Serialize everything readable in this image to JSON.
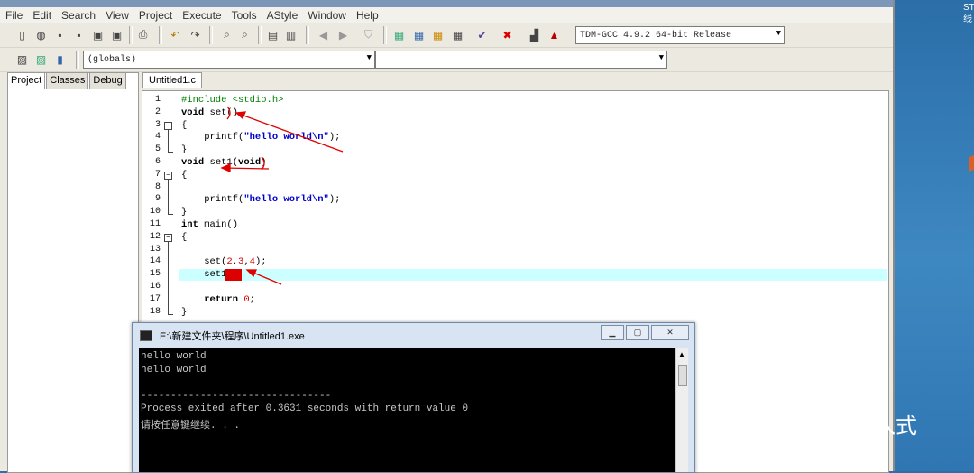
{
  "menu": [
    "File",
    "Edit",
    "Search",
    "View",
    "Project",
    "Execute",
    "Tools",
    "AStyle",
    "Window",
    "Help"
  ],
  "compiler_select": "TDM-GCC 4.9.2 64-bit Release",
  "scope_select": "(globals)",
  "panel_tabs": [
    "Project",
    "Classes",
    "Debug"
  ],
  "editor_tab": "Untitled1.c",
  "code_lines": [
    {
      "n": "1",
      "text": "#include <stdio.h>"
    },
    {
      "n": "2",
      "text": "void set()"
    },
    {
      "n": "3",
      "text": "{"
    },
    {
      "n": "4",
      "text": "    printf(\"hello world\\n\");"
    },
    {
      "n": "5",
      "text": "}"
    },
    {
      "n": "6",
      "text": "void set1(void)"
    },
    {
      "n": "7",
      "text": "{"
    },
    {
      "n": "8",
      "text": ""
    },
    {
      "n": "9",
      "text": "    printf(\"hello world\\n\");"
    },
    {
      "n": "10",
      "text": "}"
    },
    {
      "n": "11",
      "text": "int main()"
    },
    {
      "n": "12",
      "text": "{"
    },
    {
      "n": "13",
      "text": ""
    },
    {
      "n": "14",
      "text": "    set(2,3,4);"
    },
    {
      "n": "15",
      "text": "    set1();"
    },
    {
      "n": "16",
      "text": ""
    },
    {
      "n": "17",
      "text": "    return 0;"
    },
    {
      "n": "18",
      "text": "}"
    }
  ],
  "console": {
    "title": "E:\\新建文件夹\\程序\\Untitled1.exe",
    "lines": [
      "hello world",
      "hello world",
      "",
      "--------------------------------",
      "Process exited after 0.3631 seconds with return value 0",
      "请按任意键继续. . ."
    ]
  },
  "watermark": "txp学嵌入式",
  "desktop_corner": "ST\n线",
  "colors": {
    "highlight_line": "#ccffff",
    "arrow": "#e00000",
    "keyword": "#000000",
    "string": "#0000cc",
    "number": "#cc0000",
    "preproc": "#008000"
  }
}
